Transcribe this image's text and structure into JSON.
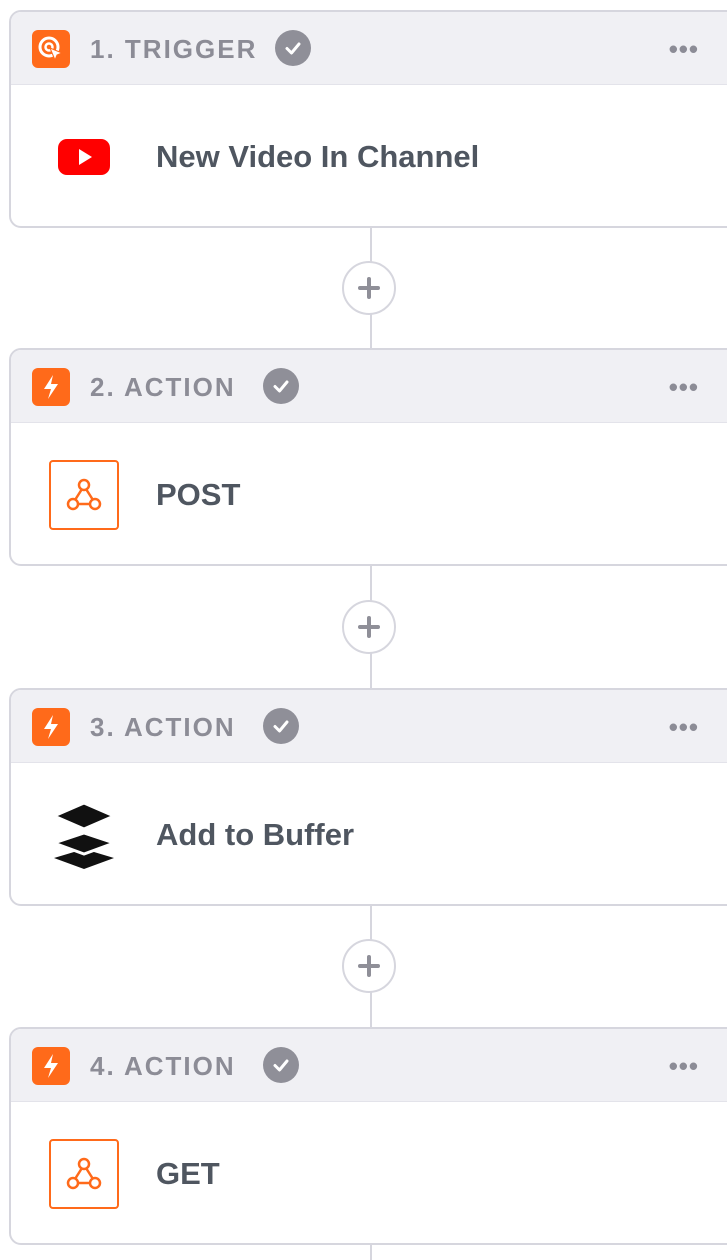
{
  "steps": [
    {
      "title": "1. TRIGGER",
      "name": "New Video In Channel",
      "badge_icon": "trigger-icon",
      "app_icon": "youtube-icon",
      "menu_label": "•••"
    },
    {
      "title": "2. ACTION",
      "name": "POST",
      "badge_icon": "lightning-icon",
      "app_icon": "webhook-icon",
      "menu_label": "•••"
    },
    {
      "title": "3. ACTION",
      "name": "Add to Buffer",
      "badge_icon": "lightning-icon",
      "app_icon": "buffer-icon",
      "menu_label": "•••"
    },
    {
      "title": "4. ACTION",
      "name": "GET",
      "badge_icon": "lightning-icon",
      "app_icon": "webhook-icon",
      "menu_label": "•••"
    }
  ],
  "colors": {
    "accent": "#ff6a1a",
    "youtube_red": "#ff0000",
    "border": "#d6d6de",
    "header_bg": "#f0f0f4",
    "header_text": "#8c8c96",
    "name_text": "#4f5660",
    "check_bg": "#8f8f98"
  }
}
